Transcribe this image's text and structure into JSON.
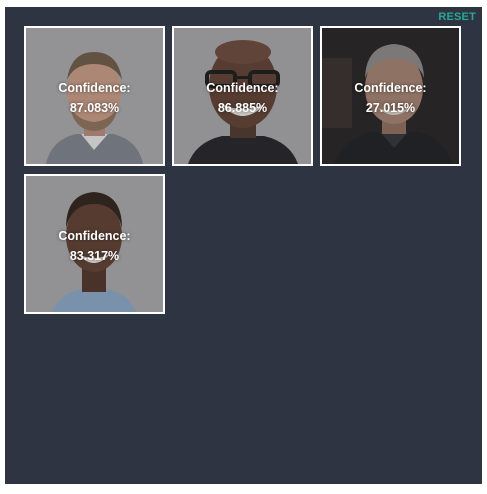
{
  "toolbar": {
    "reset_label": "RESET"
  },
  "faces": [
    {
      "confidence_label": "Confidence:",
      "confidence_value": "87.083%"
    },
    {
      "confidence_label": "Confidence:",
      "confidence_value": "86.885%"
    },
    {
      "confidence_label": "Confidence:",
      "confidence_value": "27.015%"
    },
    {
      "confidence_label": "Confidence:",
      "confidence_value": "83.317%"
    }
  ],
  "colors": {
    "background": "#2f3442",
    "accent": "#25a996",
    "card_border": "#ffffff"
  }
}
